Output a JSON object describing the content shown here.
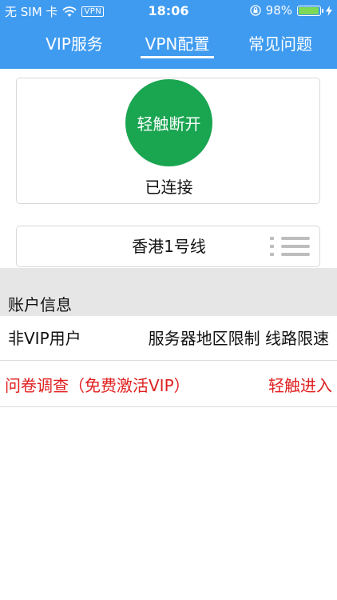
{
  "status_bar": {
    "carrier": "无 SIM 卡",
    "vpn_badge": "VPN",
    "time": "18:06",
    "battery": "98%",
    "battery_level": 0.98,
    "battery_color": "#7ed957"
  },
  "tabs": [
    {
      "label": "VIP服务"
    },
    {
      "label": "VPN配置"
    },
    {
      "label": "常见问题"
    }
  ],
  "active_tab": "VPN配置",
  "colors": {
    "header": "#3f9bf0",
    "connect_button": "#1aa551",
    "alert_text": "#e02020"
  },
  "connect": {
    "button_label": "轻触断开",
    "status": "已连接"
  },
  "server": {
    "name": "香港1号线"
  },
  "account": {
    "section_title": "账户信息",
    "user_type": "非VIP用户",
    "limits": "服务器地区限制 线路限速"
  },
  "survey": {
    "label": "问卷调查（免费激活VIP）",
    "action": "轻触进入"
  }
}
